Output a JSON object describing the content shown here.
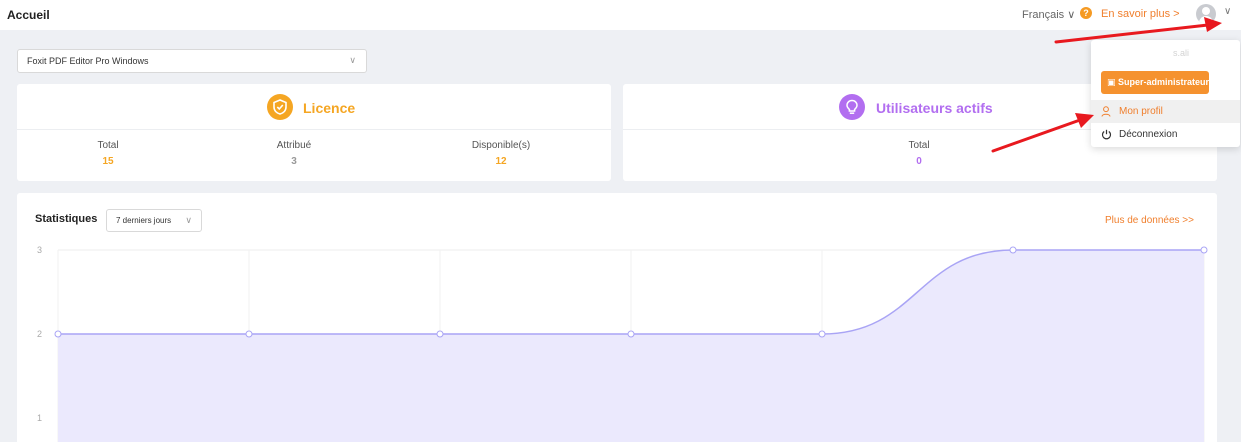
{
  "header": {
    "title": "Accueil",
    "language": "Français ∨",
    "help_icon": "?",
    "learn_more": "En savoir plus  >",
    "avatar_icon": "user-avatar",
    "avatar_chevron": "∨"
  },
  "product_select": {
    "value": "Foxit PDF Editor Pro Windows",
    "chevron": "∨"
  },
  "licence": {
    "title": "Licence",
    "icon": "shield-check-icon",
    "color": "#f5a623",
    "stats": [
      {
        "label": "Total",
        "value": "15",
        "color": "#f5a623"
      },
      {
        "label": "Attribué",
        "value": "3",
        "color": "#999999"
      },
      {
        "label": "Disponible(s)",
        "value": "12",
        "color": "#f5a623"
      }
    ]
  },
  "active_users": {
    "title": "Utilisateurs actifs",
    "icon": "lightbulb-icon",
    "color": "#b26ef0",
    "stats": [
      {
        "label": "Total",
        "value": "0",
        "color": "#b26ef0"
      }
    ]
  },
  "statistics": {
    "title": "Statistiques",
    "range": "7 derniers jours",
    "range_chevron": "∨",
    "more_link": "Plus de données >>"
  },
  "chart_data": {
    "type": "area",
    "x": [
      1,
      2,
      3,
      4,
      5,
      6,
      7
    ],
    "values": [
      2,
      2,
      2,
      2,
      2,
      3,
      3
    ],
    "ytick_labels": [
      "3",
      "2",
      "1"
    ],
    "ylim": [
      1,
      3
    ],
    "grid": true,
    "line_color": "#a9a4f5",
    "fill_color": "#ebe9fd"
  },
  "user_menu": {
    "faded_text": "s.ali",
    "role_icon": "admin-badge-icon",
    "role": "Super-administrateur",
    "items": [
      {
        "label": "Mon profil",
        "icon": "user-icon"
      },
      {
        "label": "Déconnexion",
        "icon": "power-icon"
      }
    ]
  },
  "annotation_color": "#e8191f"
}
